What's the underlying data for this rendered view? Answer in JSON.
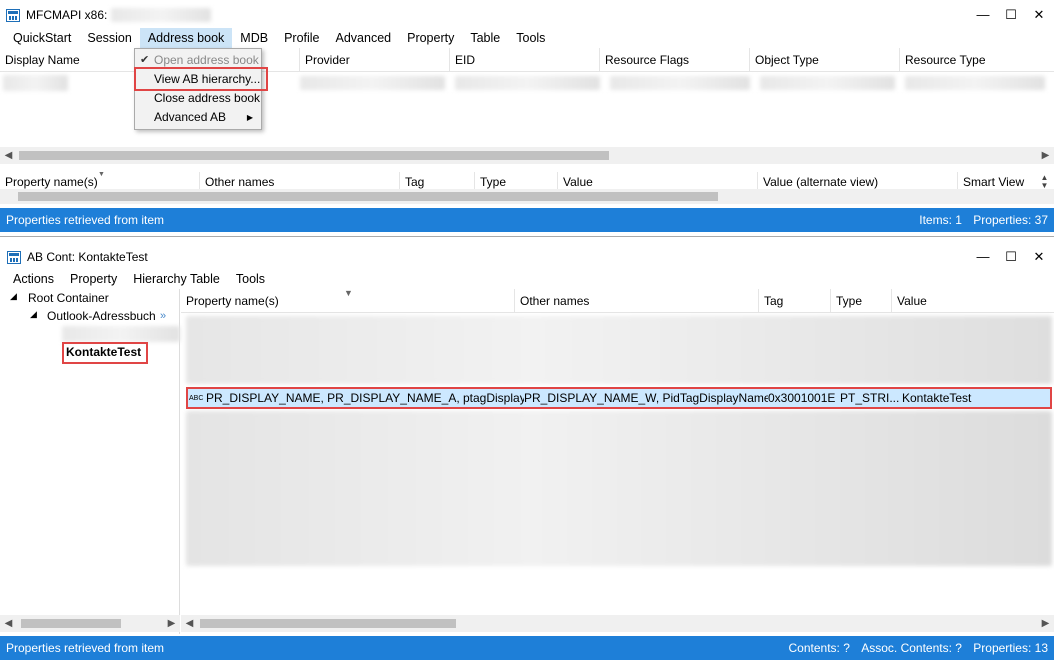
{
  "main_window": {
    "title": "MFCMAPI x86:",
    "controls": [
      "—",
      "☐",
      "✕"
    ],
    "menu": [
      {
        "label": "QuickStart"
      },
      {
        "label": "Session"
      },
      {
        "label": "Address book",
        "active": true
      },
      {
        "label": "MDB"
      },
      {
        "label": "Profile"
      },
      {
        "label": "Advanced"
      },
      {
        "label": "Property"
      },
      {
        "label": "Table"
      },
      {
        "label": "Tools"
      }
    ],
    "table_columns": [
      "Display Name",
      "",
      "Provider",
      "EID",
      "Resource Flags",
      "Object Type",
      "Resource Type"
    ],
    "property_columns": [
      "Property name(s)",
      "Other names",
      "Tag",
      "Type",
      "Value",
      "Value (alternate view)",
      "Smart View"
    ],
    "status": {
      "left": "Properties retrieved from item",
      "items": "Items: 1",
      "properties": "Properties: 37"
    }
  },
  "address_book_menu": {
    "items": [
      {
        "label": "Open address book",
        "checked": true,
        "disabled": true
      },
      {
        "label": "View AB hierarchy..."
      },
      {
        "label": "Close address book"
      },
      {
        "label": "Advanced AB",
        "submenu": true
      }
    ]
  },
  "ab_window": {
    "title": "AB Cont: KontakteTest",
    "controls": [
      "—",
      "☐",
      "✕"
    ],
    "menu": [
      {
        "label": "Actions"
      },
      {
        "label": "Property"
      },
      {
        "label": "Hierarchy Table"
      },
      {
        "label": "Tools"
      }
    ],
    "tree": {
      "root": "Root Container",
      "child": "Outlook-Adressbuch",
      "selected": "KontakteTest"
    },
    "columns": [
      "Property name(s)",
      "Other names",
      "Tag",
      "Type",
      "Value"
    ],
    "selected_row": {
      "type_icon": "ABC",
      "property_names": "PR_DISPLAY_NAME, PR_DISPLAY_NAME_A, ptagDisplayN...",
      "other_names": "PR_DISPLAY_NAME_W, PidTagDisplayName",
      "tag": "0x3001001E",
      "type": "PT_STRI...",
      "value": "KontakteTest"
    },
    "status": {
      "left": "Properties retrieved from item",
      "contents": "Contents: ?",
      "assoc": "Assoc. Contents: ?",
      "properties": "Properties: 13"
    }
  },
  "colors": {
    "status_bar": "#1e7fd8",
    "highlight_box": "#e04545",
    "menu_active": "#cce4f7",
    "selection": "#cce8ff"
  }
}
